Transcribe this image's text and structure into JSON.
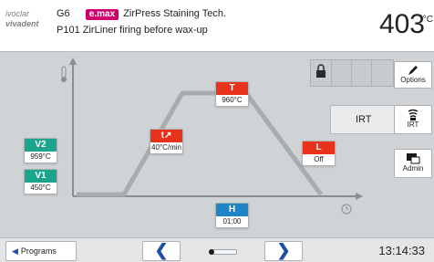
{
  "header": {
    "logo_line1": "ivoclar",
    "logo_line2": "vivadent",
    "program_no": "G6",
    "emax_badge": "e.max",
    "material_title": "ZirPress Staining Tech.",
    "program_code": "P101",
    "program_name": "ZirLiner firing before wax-up",
    "temperature": "403",
    "temperature_unit": "°C"
  },
  "params": {
    "T": {
      "label": "T",
      "value": "960°C",
      "color": "#e8321c"
    },
    "t_rate": {
      "label": "t↗",
      "value": "40°C/min",
      "color": "#e8321c"
    },
    "L": {
      "label": "L",
      "value": "Off",
      "color": "#e8321c"
    },
    "V2": {
      "label": "V2",
      "value": "959°C",
      "color": "#1aa58c"
    },
    "V1": {
      "label": "V1",
      "value": "450°C",
      "color": "#1aa58c"
    },
    "H": {
      "label": "H",
      "value": "01:00",
      "color": "#1e86c8"
    }
  },
  "side_buttons": {
    "options_label": "Options",
    "irt_label": "IRT",
    "irt_button_label": "IRT",
    "admin_label": "Admin"
  },
  "icons": {
    "thermometer": "thermometer-icon",
    "lock": "lock-icon",
    "options": "pencil-icon",
    "irt": "irt-icon",
    "admin": "admin-icon",
    "clock": "clock-icon"
  },
  "footer": {
    "programs_label": "Programs",
    "prev_label": "❮",
    "next_label": "❯",
    "time": "13:14:33"
  }
}
